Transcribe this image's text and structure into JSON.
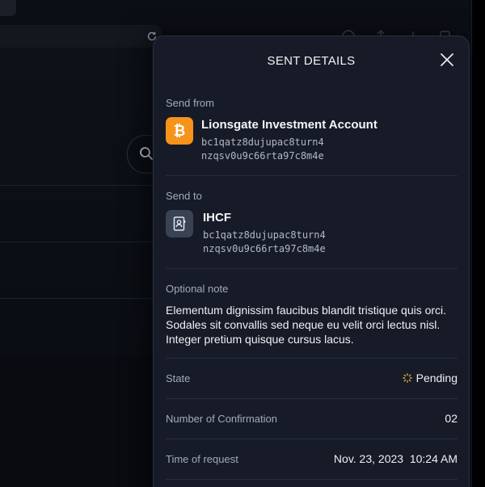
{
  "modal": {
    "title": "SENT DETAILS",
    "close_icon": "close-icon"
  },
  "send_from": {
    "label": "Send from",
    "icon": "bitcoin-icon",
    "icon_color": "#f7931a",
    "name": "Lionsgate Investment Account",
    "address_line1": "bc1qatz8dujupac8turn4",
    "address_line2": "nzqsv0u9c66rta97c8m4e"
  },
  "send_to": {
    "label": "Send to",
    "icon": "contact-book-icon",
    "name": "IHCF",
    "address_line1": "bc1qatz8dujupac8turn4",
    "address_line2": "nzqsv0u9c66rta97c8m4e"
  },
  "note": {
    "label": "Optional note",
    "text": "Elementum dignissim faucibus blandit tristique quis orci. Sodales sit convallis sed neque eu velit orci lectus nisl. Integer pretium quisque cursus lacus."
  },
  "details": {
    "state_label": "State",
    "state_value": "Pending",
    "state_icon": "spinner-icon",
    "state_color": "#d9a441",
    "confirmations_label": "Number of Confirmation",
    "confirmations_value": "02",
    "time_label": "Time of request",
    "time_value": "Nov. 23, 2023  10:24 AM"
  }
}
